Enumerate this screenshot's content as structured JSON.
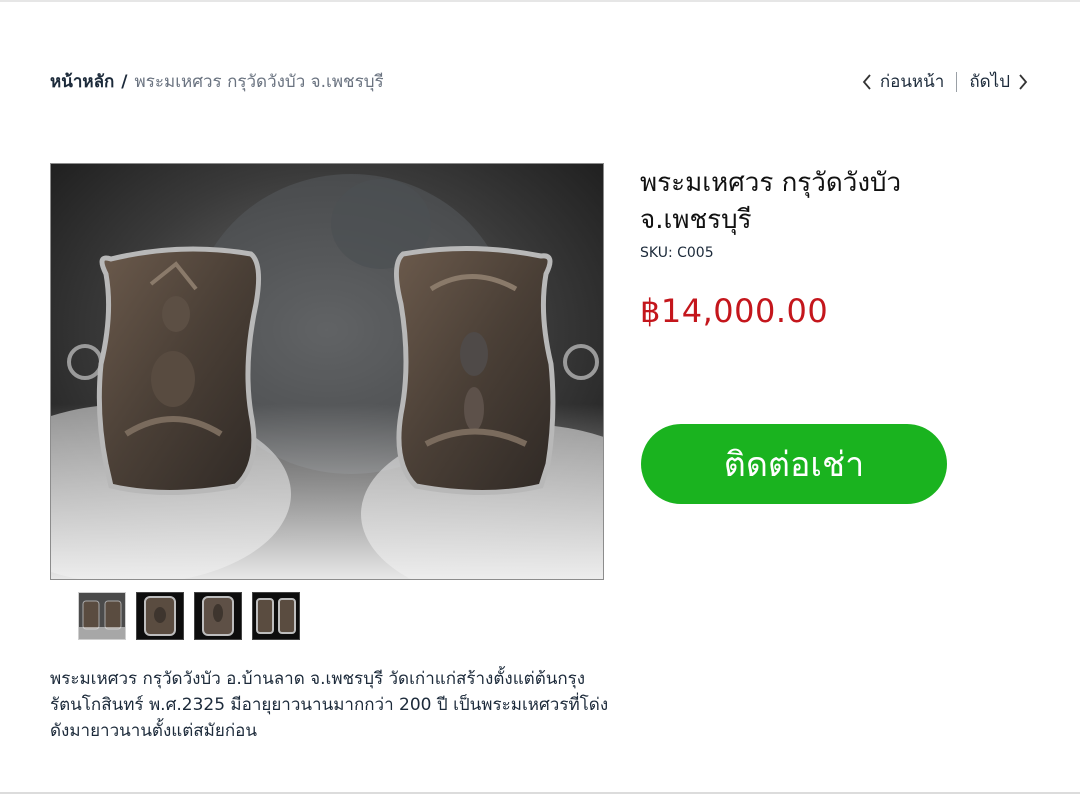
{
  "breadcrumb": {
    "home": "หน้าหลัก",
    "separator": "/",
    "current": "พระมเหศวร กรุวัดวังบัว จ.เพชรบุรี"
  },
  "pager": {
    "prev_label": "ก่อนหน้า",
    "next_label": "ถัดไป"
  },
  "product": {
    "title": "พระมเหศวร กรุวัดวังบัว จ.เพชรบุรี",
    "sku_label": "SKU:",
    "sku": "C005",
    "price": "฿14,000.00",
    "contact_button": "ติดต่อเช่า",
    "description": "พระมเหศวร กรุวัดวังบัว อ.บ้านลาด จ.เพชรบุรี วัดเก่าแก่สร้างตั้งแต่ต้นกรุงรัตนโกสินทร์ พ.ศ.2325 มีอายุยาวนานมากกว่า 200 ปี เป็นพระมเหศวรที่โด่งดังมายาวนานตั้งแต่สมัยก่อน"
  },
  "gallery": {
    "thumbnail_count": 4,
    "selected_index": 0
  },
  "colors": {
    "price": "#c4161c",
    "contact_button": "#1ab31f",
    "breadcrumb_link": "#1c2a3a",
    "breadcrumb_current": "#6a7380"
  },
  "icons": {
    "prev": "chevron-left-icon",
    "next": "chevron-right-icon"
  }
}
